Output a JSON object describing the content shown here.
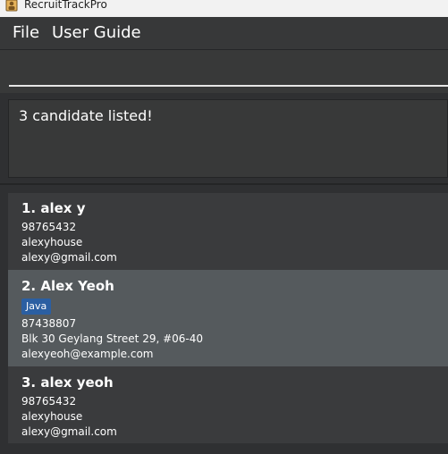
{
  "window": {
    "title": "RecruitTrackPro",
    "icon": "app-icon"
  },
  "menu": {
    "items": [
      "File",
      "User Guide"
    ]
  },
  "command": {
    "value": "",
    "placeholder": ""
  },
  "result": {
    "text": "3 candidate listed!"
  },
  "candidates": [
    {
      "header": "1.  alex y",
      "tags": [],
      "phone": "98765432",
      "address": "alexyhouse",
      "email": "alexy@gmail.com"
    },
    {
      "header": "2.  Alex Yeoh",
      "tags": [
        "Java"
      ],
      "phone": "87438807",
      "address": "Blk 30 Geylang Street 29, #06-40",
      "email": "alexyeoh@example.com"
    },
    {
      "header": "3.  alex yeoh",
      "tags": [],
      "phone": "98765432",
      "address": "alexyhouse",
      "email": "alexy@gmail.com"
    }
  ],
  "colors": {
    "background": "#2f3032",
    "panel": "#3a3b3d",
    "selected": "#555a5d",
    "tag": "#2b5fa2",
    "text": "#ffffff"
  }
}
